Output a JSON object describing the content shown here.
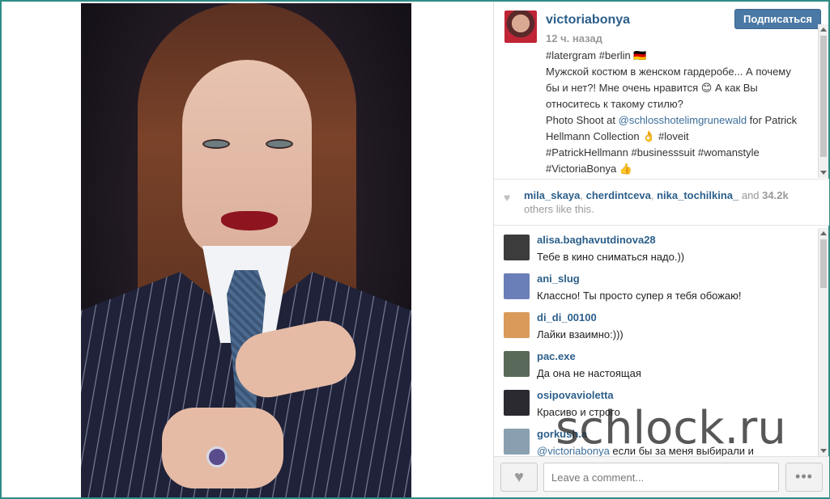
{
  "post": {
    "username": "victoriabonya",
    "follow_label": "Подписаться",
    "time": "12 ч. назад",
    "caption_lines": [
      "#latergram #berlin 🇩🇪",
      "Мужской костюм в женском гардеробе... А почему",
      "бы и нет?! Мне очень нравится 😊 А как Вы",
      "относитесь к такому стилю?"
    ],
    "caption_shoot_prefix": "Photo Shoot at ",
    "caption_shoot_mention": "@schlosshotelimgrunewald",
    "caption_shoot_suffix": " for Patrick",
    "caption_lines_2": [
      "Hellmann Collection 👌 #loveit",
      "#PatrickHellmann #businesssuit #womanstyle",
      "#VictoriaBonya 👍"
    ]
  },
  "likes": {
    "users": [
      "mila_skaya",
      "cherdintceva",
      "nika_tochilkina_"
    ],
    "sep": ", ",
    "and": " and ",
    "count": "34.2k",
    "suffix": "others like this."
  },
  "comments": [
    {
      "user": "alisa.baghavutdinova28",
      "text": "Тебе в кино сниматься надо.))",
      "avatar_color": "#3c3c3c"
    },
    {
      "user": "ani_slug",
      "text": "Классно! Ты просто супер я тебя обожаю!",
      "avatar_color": "#6a7fb8"
    },
    {
      "user": "di_di_00100",
      "text": "Лайки взаимно:)))",
      "avatar_color": "#d99a5a"
    },
    {
      "user": "pac.exe",
      "text": "Да она не настоящая",
      "avatar_color": "#5a6a5a"
    },
    {
      "user": "osipovavioletta",
      "text": "Красиво и строго",
      "avatar_color": "#2a2a30"
    },
    {
      "user": "gorkush.a",
      "mention": "@victoriabonya",
      "text": " если бы за меня выбирали и",
      "avatar_color": "#8aa0b0"
    }
  ],
  "footer": {
    "comment_placeholder": "Leave a comment...",
    "like_icon": "♥",
    "more_icon": "•••"
  },
  "watermark": "schlock.ru"
}
